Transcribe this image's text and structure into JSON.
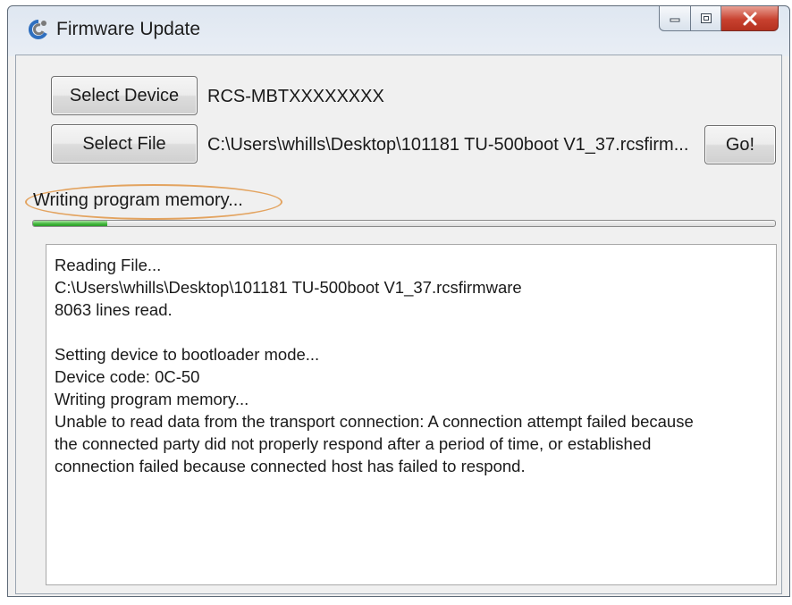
{
  "window": {
    "title": "Firmware Update",
    "app_icon": "firmware-app-icon"
  },
  "caption_buttons": {
    "minimize_icon": "minimize-icon",
    "maximize_icon": "maximize-icon",
    "close_icon": "close-icon"
  },
  "device": {
    "button_label": "Select Device",
    "value": "RCS-MBTXXXXXXXX"
  },
  "file": {
    "button_label": "Select File",
    "value": "C:\\Users\\whills\\Desktop\\101181 TU-500boot V1_37.rcsfirm...",
    "go_label": "Go!"
  },
  "status": {
    "text": "Writing program memory...",
    "progress": 0.1,
    "highlight_color": "#e3a35f"
  },
  "log": {
    "lines": [
      "Reading File...",
      "C:\\Users\\whills\\Desktop\\101181 TU-500boot V1_37.rcsfirmware",
      "8063 lines read.",
      "",
      "Setting device to bootloader mode...",
      "Device code: 0C-50",
      "Writing program memory...",
      "Unable to read data from the transport connection: A connection attempt failed because",
      "the connected party did not properly respond after a period of time, or established",
      "connection failed because connected host has failed to respond."
    ]
  }
}
